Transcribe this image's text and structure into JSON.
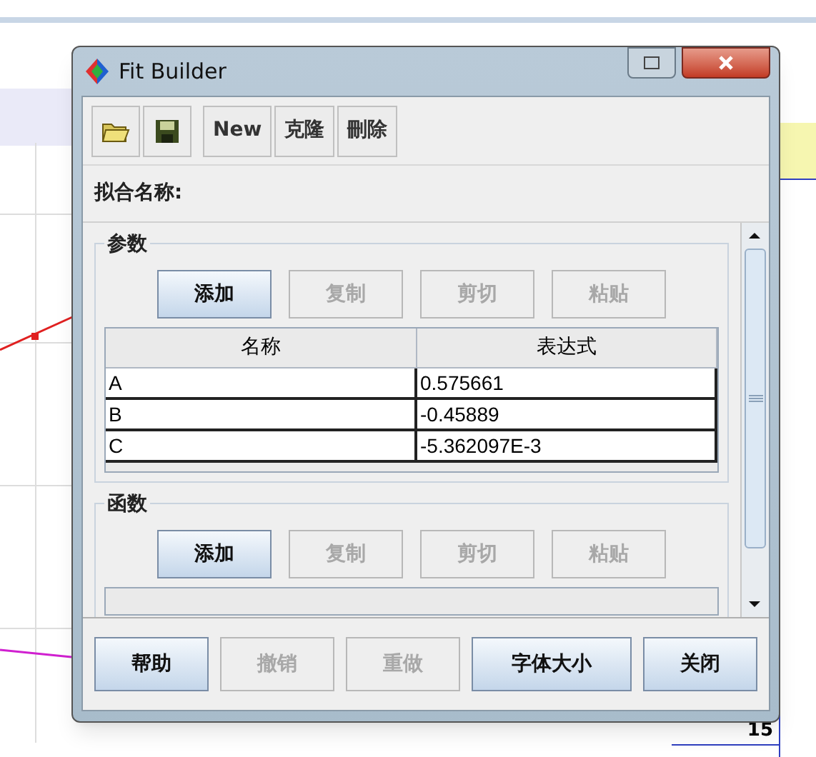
{
  "window": {
    "title": "Fit Builder"
  },
  "toolbar": [
    {
      "kind": "open"
    },
    {
      "kind": "save"
    },
    {
      "kind": "text",
      "label": "New"
    },
    {
      "kind": "text",
      "label": "克隆"
    },
    {
      "kind": "text",
      "label": "刪除"
    }
  ],
  "fit_name": {
    "label": "拟合名称:"
  },
  "parameters": {
    "title": "参数",
    "buttons": [
      {
        "label": "添加",
        "disabled": false
      },
      {
        "label": "复制",
        "disabled": true
      },
      {
        "label": "剪切",
        "disabled": true
      },
      {
        "label": "粘贴",
        "disabled": true
      }
    ],
    "columns": [
      "名称",
      "表达式"
    ],
    "rows": [
      [
        "A",
        "0.575661"
      ],
      [
        "B",
        "-0.45889"
      ],
      [
        "C",
        "-5.362097E-3"
      ]
    ]
  },
  "functions": {
    "title": "函数",
    "buttons": [
      {
        "label": "添加",
        "disabled": false
      },
      {
        "label": "复制",
        "disabled": true
      },
      {
        "label": "剪切",
        "disabled": true
      },
      {
        "label": "粘贴",
        "disabled": true
      }
    ]
  },
  "footer_buttons": [
    {
      "label": "帮助",
      "disabled": false
    },
    {
      "label": "撤销",
      "disabled": true
    },
    {
      "label": "重做",
      "disabled": true
    },
    {
      "label": "字体大小",
      "disabled": false
    },
    {
      "label": "关闭",
      "disabled": false
    }
  ],
  "background_table": {
    "row_labels": [
      "15"
    ]
  }
}
